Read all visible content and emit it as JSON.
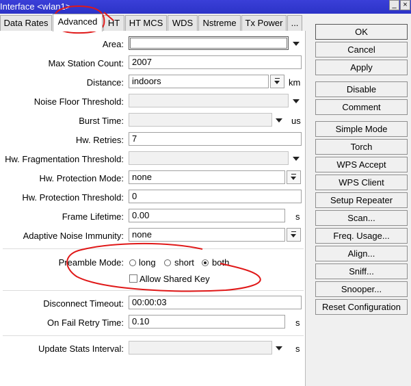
{
  "window": {
    "title": "Interface <wlan1>",
    "minimize_label": "_",
    "close_label": "×"
  },
  "tabs": [
    {
      "label": "Data Rates",
      "active": false
    },
    {
      "label": "Advanced",
      "active": true
    },
    {
      "label": "HT",
      "active": false
    },
    {
      "label": "HT MCS",
      "active": false
    },
    {
      "label": "WDS",
      "active": false
    },
    {
      "label": "Nstreme",
      "active": false
    },
    {
      "label": "Tx Power",
      "active": false
    },
    {
      "label": "...",
      "active": false
    }
  ],
  "form": {
    "area": {
      "label": "Area:",
      "value": ""
    },
    "max_station_count": {
      "label": "Max Station Count:",
      "value": "2007"
    },
    "distance": {
      "label": "Distance:",
      "value": "indoors",
      "unit": "km"
    },
    "noise_floor_threshold": {
      "label": "Noise Floor Threshold:",
      "value": ""
    },
    "burst_time": {
      "label": "Burst Time:",
      "value": "",
      "unit": "us"
    },
    "hw_retries": {
      "label": "Hw. Retries:",
      "value": "7"
    },
    "hw_fragmentation_threshold": {
      "label": "Hw. Fragmentation Threshold:",
      "value": ""
    },
    "hw_protection_mode": {
      "label": "Hw. Protection Mode:",
      "value": "none"
    },
    "hw_protection_threshold": {
      "label": "Hw. Protection Threshold:",
      "value": "0"
    },
    "frame_lifetime": {
      "label": "Frame Lifetime:",
      "value": "0.00",
      "unit": "s"
    },
    "adaptive_noise_immunity": {
      "label": "Adaptive Noise Immunity:",
      "value": "none"
    },
    "preamble_mode": {
      "label": "Preamble Mode:",
      "options": [
        "long",
        "short",
        "both"
      ],
      "selected": "both"
    },
    "allow_shared_key": {
      "label": "Allow Shared Key",
      "checked": false
    },
    "disconnect_timeout": {
      "label": "Disconnect Timeout:",
      "value": "00:00:03"
    },
    "on_fail_retry_time": {
      "label": "On Fail Retry Time:",
      "value": "0.10",
      "unit": "s"
    },
    "update_stats_interval": {
      "label": "Update Stats Interval:",
      "value": "",
      "unit": "s"
    }
  },
  "buttons": {
    "ok": "OK",
    "cancel": "Cancel",
    "apply": "Apply",
    "disable": "Disable",
    "comment": "Comment",
    "simple_mode": "Simple Mode",
    "torch": "Torch",
    "wps_accept": "WPS Accept",
    "wps_client": "WPS Client",
    "setup_repeater": "Setup Repeater",
    "scan": "Scan...",
    "freq_usage": "Freq. Usage...",
    "align": "Align...",
    "sniff": "Sniff...",
    "snooper": "Snooper...",
    "reset_configuration": "Reset Configuration"
  },
  "colors": {
    "titlebar": "#3a3fd8",
    "annotation": "#e01818"
  }
}
